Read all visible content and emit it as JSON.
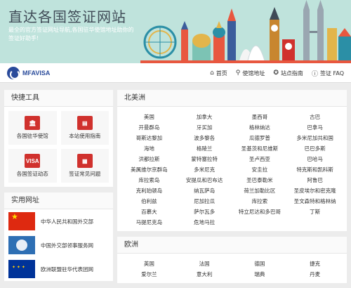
{
  "banner": {
    "title": "直达各国签证网站",
    "subtitle": "最全的官方签证网址导航,各国驻华使馆地址助你的签证好助手!"
  },
  "nav": {
    "logo_text": "MFAVISA",
    "items": [
      {
        "label": "首页",
        "icon": "home-icon"
      },
      {
        "label": "使馆地址",
        "icon": "map-pin-icon"
      },
      {
        "label": "站点指南",
        "icon": "compass-icon"
      },
      {
        "label": "签证 FAQ",
        "icon": "info-icon"
      }
    ]
  },
  "sidebar": {
    "tools_title": "快捷工具",
    "tools": [
      {
        "label": "各国驻华使馆",
        "icon": "embassy-icon"
      },
      {
        "label": "本站使用指南",
        "icon": "book-icon"
      },
      {
        "label": "各国签证动态",
        "icon": "visa-icon",
        "icon_text": "VISA"
      },
      {
        "label": "签证常见问题",
        "icon": "faq-icon"
      }
    ],
    "links_title": "实用网址",
    "links": [
      {
        "label": "中华人民共和国外交部",
        "icon": "china-flag-icon"
      },
      {
        "label": "中国外交部领事服务网",
        "icon": "consular-emblem-icon"
      },
      {
        "label": "欧洲联盟驻华代表团网",
        "icon": "eu-flag-icon"
      }
    ]
  },
  "regions": [
    {
      "title": "北美洲",
      "countries": [
        "美国",
        "加拿大",
        "墨西哥",
        "古巴",
        "开曼群岛",
        "牙买加",
        "格林纳达",
        "巴拿马",
        "哥斯达黎加",
        "波多黎各",
        "瓜德罗普",
        "多米尼加共和国",
        "海地",
        "格陵兰",
        "圣基茨和尼维斯",
        "巴巴多斯",
        "洪都拉斯",
        "蒙特塞拉特",
        "圣卢西亚",
        "巴哈马",
        "美属维尔京群岛",
        "多米尼克",
        "安圭拉",
        "特克斯和凯科斯",
        "库拉索岛",
        "安提瓜和巴布达",
        "圣巴泰勒米",
        "阿鲁巴",
        "克利珀顿岛",
        "纳瓦萨岛",
        "荷兰加勒比区",
        "圣皮埃尔和密克隆",
        "伯利兹",
        "尼加拉瓜",
        "库拉索",
        "圣文森特和格林纳",
        "百慕大",
        "萨尔瓦多",
        "特立尼达和多巴哥",
        "丁斯",
        "马提尼克岛",
        "危地马拉"
      ]
    },
    {
      "title": "欧洲",
      "countries": [
        "英国",
        "法国",
        "德国",
        "捷克",
        "爱尔兰",
        "意大利",
        "瑞典",
        "丹麦"
      ]
    }
  ],
  "colors": {
    "banner_bg": "#bfe3dc",
    "accent_red": "#d0312d",
    "logo_blue": "#2a4b9b"
  }
}
